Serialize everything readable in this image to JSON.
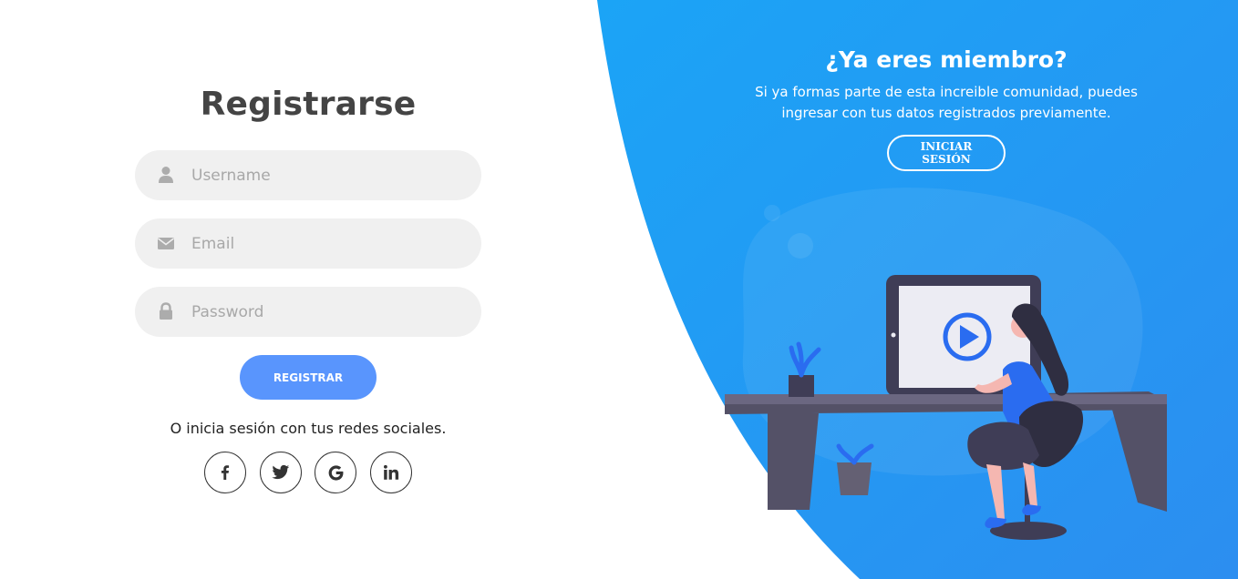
{
  "signup_form": {
    "title": "Registrarse",
    "username": {
      "placeholder": "Username",
      "value": "",
      "icon": "user-icon"
    },
    "email": {
      "placeholder": "Email",
      "value": "",
      "icon": "envelope-icon"
    },
    "password": {
      "placeholder": "Password",
      "value": "",
      "icon": "lock-icon"
    },
    "submit_label": "REGISTRAR",
    "social_text": "O inicia sesión con tus redes sociales.",
    "social_buttons": [
      {
        "name": "facebook-icon",
        "glyph": "f"
      },
      {
        "name": "twitter-icon",
        "glyph": ""
      },
      {
        "name": "google-icon",
        "glyph": "G"
      },
      {
        "name": "linkedin-icon",
        "glyph": "in"
      }
    ]
  },
  "right_panel": {
    "title": "¿Ya eres miembro?",
    "description": "Si ya formas parte de esta increible comunidad, puedes ingresar con tus datos registrados previamente.",
    "button_label": "INICIAR SESIÓN",
    "illustration": "person-at-desk-watching-video-illustration"
  },
  "colors": {
    "accent": "#5995fd",
    "panel_gradient_start": "#1c9ef5",
    "panel_gradient_end": "#2a93f0",
    "input_bg": "#f0f0f0",
    "title_text": "#444444"
  }
}
